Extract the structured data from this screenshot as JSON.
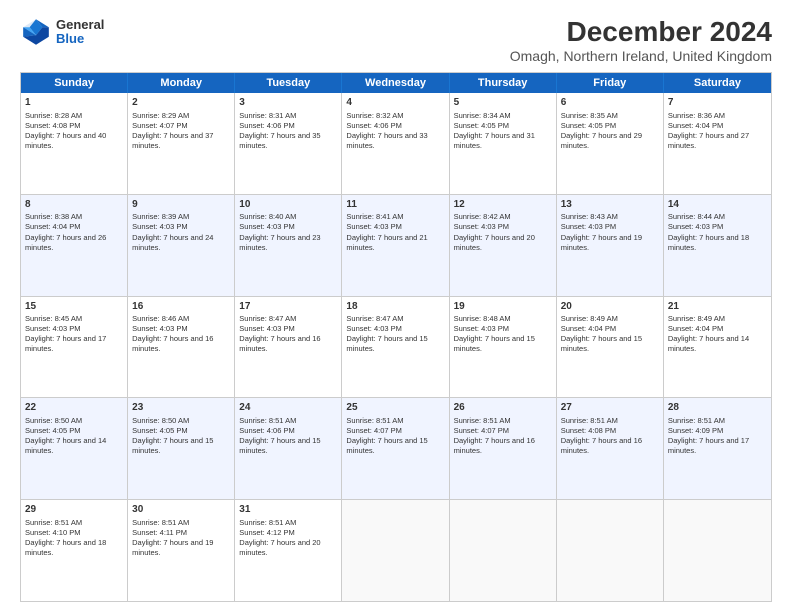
{
  "logo": {
    "general": "General",
    "blue": "Blue"
  },
  "title": "December 2024",
  "subtitle": "Omagh, Northern Ireland, United Kingdom",
  "days": [
    "Sunday",
    "Monday",
    "Tuesday",
    "Wednesday",
    "Thursday",
    "Friday",
    "Saturday"
  ],
  "weeks": [
    [
      {
        "day": "1",
        "sunrise": "Sunrise: 8:28 AM",
        "sunset": "Sunset: 4:08 PM",
        "daylight": "Daylight: 7 hours and 40 minutes."
      },
      {
        "day": "2",
        "sunrise": "Sunrise: 8:29 AM",
        "sunset": "Sunset: 4:07 PM",
        "daylight": "Daylight: 7 hours and 37 minutes."
      },
      {
        "day": "3",
        "sunrise": "Sunrise: 8:31 AM",
        "sunset": "Sunset: 4:06 PM",
        "daylight": "Daylight: 7 hours and 35 minutes."
      },
      {
        "day": "4",
        "sunrise": "Sunrise: 8:32 AM",
        "sunset": "Sunset: 4:06 PM",
        "daylight": "Daylight: 7 hours and 33 minutes."
      },
      {
        "day": "5",
        "sunrise": "Sunrise: 8:34 AM",
        "sunset": "Sunset: 4:05 PM",
        "daylight": "Daylight: 7 hours and 31 minutes."
      },
      {
        "day": "6",
        "sunrise": "Sunrise: 8:35 AM",
        "sunset": "Sunset: 4:05 PM",
        "daylight": "Daylight: 7 hours and 29 minutes."
      },
      {
        "day": "7",
        "sunrise": "Sunrise: 8:36 AM",
        "sunset": "Sunset: 4:04 PM",
        "daylight": "Daylight: 7 hours and 27 minutes."
      }
    ],
    [
      {
        "day": "8",
        "sunrise": "Sunrise: 8:38 AM",
        "sunset": "Sunset: 4:04 PM",
        "daylight": "Daylight: 7 hours and 26 minutes."
      },
      {
        "day": "9",
        "sunrise": "Sunrise: 8:39 AM",
        "sunset": "Sunset: 4:03 PM",
        "daylight": "Daylight: 7 hours and 24 minutes."
      },
      {
        "day": "10",
        "sunrise": "Sunrise: 8:40 AM",
        "sunset": "Sunset: 4:03 PM",
        "daylight": "Daylight: 7 hours and 23 minutes."
      },
      {
        "day": "11",
        "sunrise": "Sunrise: 8:41 AM",
        "sunset": "Sunset: 4:03 PM",
        "daylight": "Daylight: 7 hours and 21 minutes."
      },
      {
        "day": "12",
        "sunrise": "Sunrise: 8:42 AM",
        "sunset": "Sunset: 4:03 PM",
        "daylight": "Daylight: 7 hours and 20 minutes."
      },
      {
        "day": "13",
        "sunrise": "Sunrise: 8:43 AM",
        "sunset": "Sunset: 4:03 PM",
        "daylight": "Daylight: 7 hours and 19 minutes."
      },
      {
        "day": "14",
        "sunrise": "Sunrise: 8:44 AM",
        "sunset": "Sunset: 4:03 PM",
        "daylight": "Daylight: 7 hours and 18 minutes."
      }
    ],
    [
      {
        "day": "15",
        "sunrise": "Sunrise: 8:45 AM",
        "sunset": "Sunset: 4:03 PM",
        "daylight": "Daylight: 7 hours and 17 minutes."
      },
      {
        "day": "16",
        "sunrise": "Sunrise: 8:46 AM",
        "sunset": "Sunset: 4:03 PM",
        "daylight": "Daylight: 7 hours and 16 minutes."
      },
      {
        "day": "17",
        "sunrise": "Sunrise: 8:47 AM",
        "sunset": "Sunset: 4:03 PM",
        "daylight": "Daylight: 7 hours and 16 minutes."
      },
      {
        "day": "18",
        "sunrise": "Sunrise: 8:47 AM",
        "sunset": "Sunset: 4:03 PM",
        "daylight": "Daylight: 7 hours and 15 minutes."
      },
      {
        "day": "19",
        "sunrise": "Sunrise: 8:48 AM",
        "sunset": "Sunset: 4:03 PM",
        "daylight": "Daylight: 7 hours and 15 minutes."
      },
      {
        "day": "20",
        "sunrise": "Sunrise: 8:49 AM",
        "sunset": "Sunset: 4:04 PM",
        "daylight": "Daylight: 7 hours and 15 minutes."
      },
      {
        "day": "21",
        "sunrise": "Sunrise: 8:49 AM",
        "sunset": "Sunset: 4:04 PM",
        "daylight": "Daylight: 7 hours and 14 minutes."
      }
    ],
    [
      {
        "day": "22",
        "sunrise": "Sunrise: 8:50 AM",
        "sunset": "Sunset: 4:05 PM",
        "daylight": "Daylight: 7 hours and 14 minutes."
      },
      {
        "day": "23",
        "sunrise": "Sunrise: 8:50 AM",
        "sunset": "Sunset: 4:05 PM",
        "daylight": "Daylight: 7 hours and 15 minutes."
      },
      {
        "day": "24",
        "sunrise": "Sunrise: 8:51 AM",
        "sunset": "Sunset: 4:06 PM",
        "daylight": "Daylight: 7 hours and 15 minutes."
      },
      {
        "day": "25",
        "sunrise": "Sunrise: 8:51 AM",
        "sunset": "Sunset: 4:07 PM",
        "daylight": "Daylight: 7 hours and 15 minutes."
      },
      {
        "day": "26",
        "sunrise": "Sunrise: 8:51 AM",
        "sunset": "Sunset: 4:07 PM",
        "daylight": "Daylight: 7 hours and 16 minutes."
      },
      {
        "day": "27",
        "sunrise": "Sunrise: 8:51 AM",
        "sunset": "Sunset: 4:08 PM",
        "daylight": "Daylight: 7 hours and 16 minutes."
      },
      {
        "day": "28",
        "sunrise": "Sunrise: 8:51 AM",
        "sunset": "Sunset: 4:09 PM",
        "daylight": "Daylight: 7 hours and 17 minutes."
      }
    ],
    [
      {
        "day": "29",
        "sunrise": "Sunrise: 8:51 AM",
        "sunset": "Sunset: 4:10 PM",
        "daylight": "Daylight: 7 hours and 18 minutes."
      },
      {
        "day": "30",
        "sunrise": "Sunrise: 8:51 AM",
        "sunset": "Sunset: 4:11 PM",
        "daylight": "Daylight: 7 hours and 19 minutes."
      },
      {
        "day": "31",
        "sunrise": "Sunrise: 8:51 AM",
        "sunset": "Sunset: 4:12 PM",
        "daylight": "Daylight: 7 hours and 20 minutes."
      },
      null,
      null,
      null,
      null
    ]
  ]
}
